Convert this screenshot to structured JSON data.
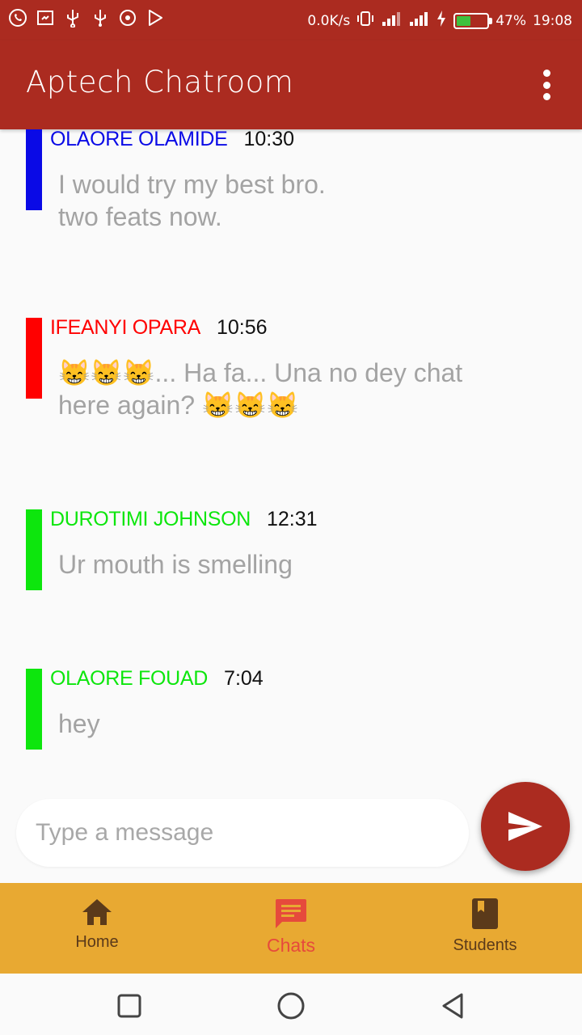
{
  "status_bar": {
    "left_icons": [
      "whatsapp-icon",
      "screenshot-icon",
      "usb-icon",
      "usb-icon",
      "camera-icon",
      "play-store-icon"
    ],
    "net_speed": "0.0K/s",
    "battery_percent": "47%",
    "battery_level": 0.47,
    "time": "19:08"
  },
  "app_bar": {
    "title": "Aptech Chatroom",
    "menu_icon": "more-vert-icon"
  },
  "messages": [
    {
      "author": "OLAORE OLAMIDE",
      "time": "10:30",
      "text": "I would try my best bro.\ntwo feats now.",
      "color": "#0a0ae6"
    },
    {
      "author": "IFEANYI OPARA",
      "time": "10:56",
      "text": "😸😸😸... Ha fa... Una no dey chat here again? 😸😸😸",
      "color": "#ff0000"
    },
    {
      "author": "DUROTIMI JOHNSON",
      "time": "12:31",
      "text": "Ur mouth is smelling",
      "color": "#0de60d"
    },
    {
      "author": "OLAORE FOUAD",
      "time": "7:04",
      "text": "hey",
      "color": "#0de60d"
    }
  ],
  "composer": {
    "placeholder": "Type a message",
    "send_icon": "send-icon"
  },
  "bottom_nav": {
    "items": [
      {
        "label": "Home",
        "icon": "home-icon",
        "active": false
      },
      {
        "label": "Chats",
        "icon": "chat-icon",
        "active": true
      },
      {
        "label": "Students",
        "icon": "book-icon",
        "active": false
      }
    ]
  },
  "colors": {
    "primary": "#ab2b20",
    "nav_bg": "#e8a932",
    "nav_active": "#e64a3c",
    "nav_inactive": "#5b3a1a"
  }
}
